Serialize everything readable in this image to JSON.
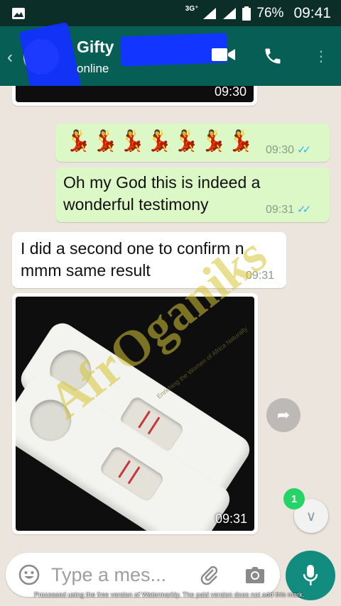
{
  "status_bar": {
    "network": "3G⁺",
    "battery": "76%",
    "time": "09:41"
  },
  "header": {
    "contact_name": "Gifty",
    "contact_status": "online",
    "back_icon": "back-arrow-icon",
    "video_icon": "video-call-icon",
    "call_icon": "phone-icon",
    "more_icon": "more-vert-icon",
    "accent": "#075e54"
  },
  "messages": [
    {
      "kind": "image-tail",
      "direction": "in",
      "time": "09:30"
    },
    {
      "kind": "emoji",
      "direction": "out",
      "emojis": "💃💃💃💃💃💃💃",
      "time": "09:30",
      "ticks": "✓✓"
    },
    {
      "kind": "text",
      "direction": "out",
      "text": "Oh my God this is indeed a wonderful testimony",
      "time": "09:31",
      "ticks": "✓✓"
    },
    {
      "kind": "text",
      "direction": "in",
      "text": "I did a second one to confirm n mmm same result",
      "time": "09:31"
    },
    {
      "kind": "image",
      "direction": "in",
      "time": "09:31"
    }
  ],
  "watermark": {
    "brand": "AfrOganiks",
    "tagline": "Enriching the Women of Africa Naturally"
  },
  "floating": {
    "unread_count": "1",
    "forward_icon": "forward-icon",
    "scroll_icon": "double-chevron-down-icon"
  },
  "input": {
    "placeholder": "Type a mes...",
    "emoji_icon": "emoji-icon",
    "attach_icon": "paperclip-icon",
    "camera_icon": "camera-icon",
    "mic_icon": "mic-icon"
  },
  "footer_note": "Processed using the free version of Watermarkly. The paid version does not add this mark.",
  "colors": {
    "incoming": "#ffffff",
    "outgoing": "#dcf8c6",
    "read_tick": "#34b7f1",
    "mic_button": "#128c7e"
  }
}
